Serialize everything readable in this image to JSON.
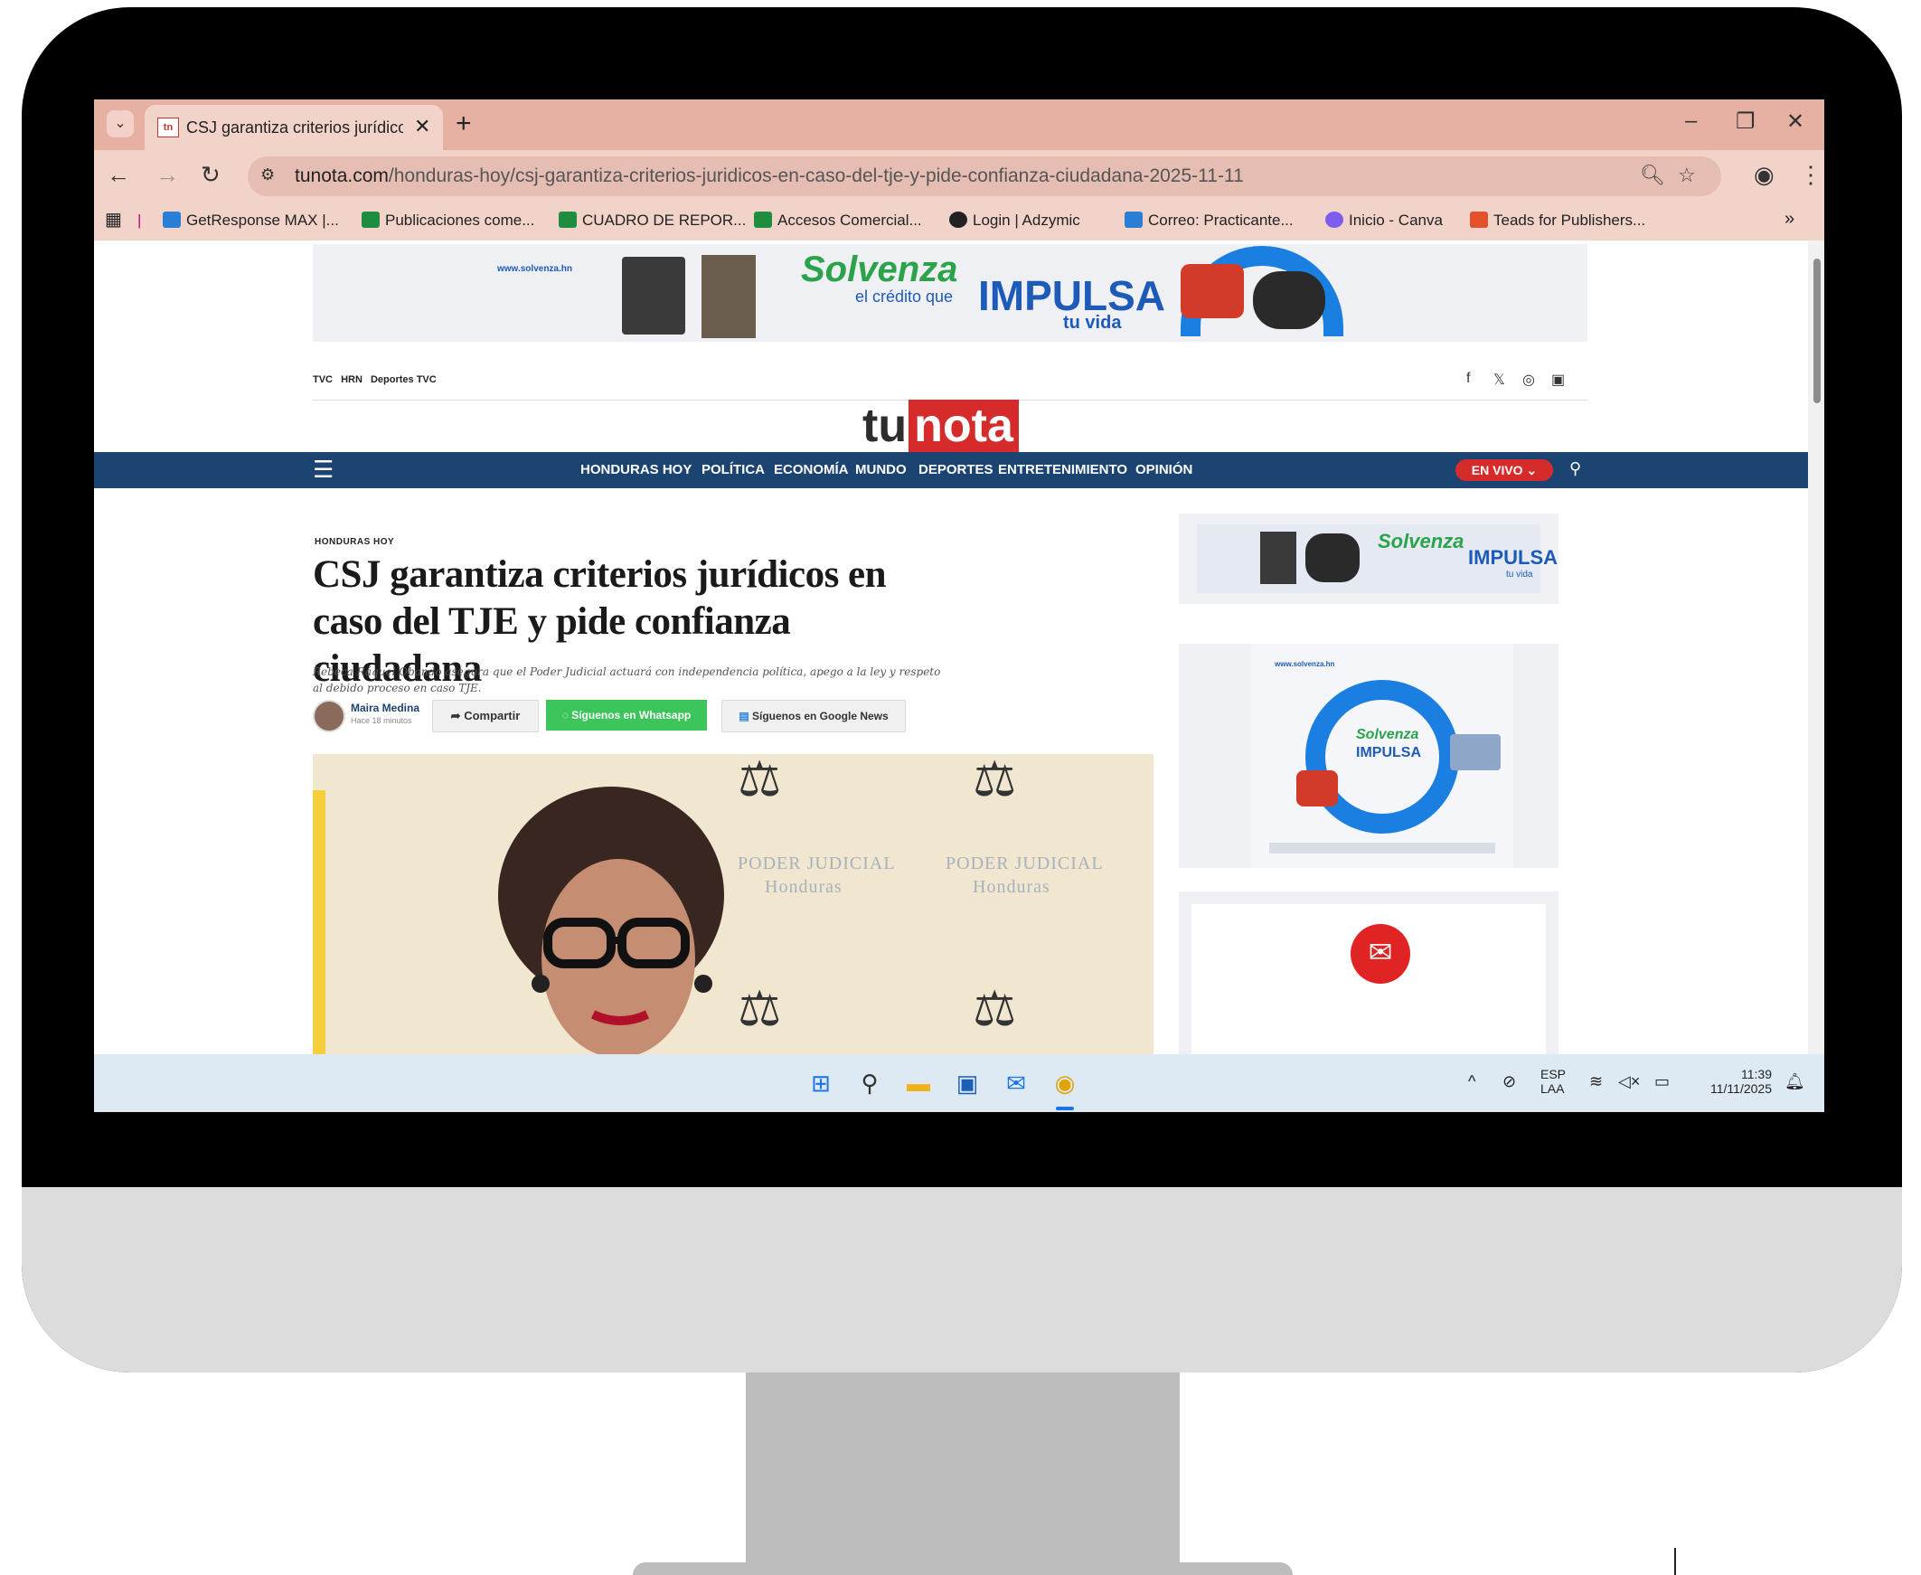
{
  "browser": {
    "tab_title": "CSJ garantiza criterios jurídicos",
    "tab_favicon": "tn",
    "url_domain": "tunota.com",
    "url_path": "/honduras-hoy/csj-garantiza-criterios-juridicos-en-caso-del-tje-y-pide-confianza-ciudadana-2025-11-11",
    "bookmarks": [
      {
        "label": "GetResponse MAX |...",
        "color": "#2a7fd4"
      },
      {
        "label": "Publicaciones come...",
        "color": "#1e8e3e"
      },
      {
        "label": "CUADRO DE REPOR...",
        "color": "#1e8e3e"
      },
      {
        "label": "Accesos Comercial...",
        "color": "#1e8e3e"
      },
      {
        "label": "Login | Adzymic",
        "color": "#222222"
      },
      {
        "label": "Correo: Practicante...",
        "color": "#2a7fd4"
      },
      {
        "label": "Inicio - Canva",
        "color": "#7d5cf0"
      },
      {
        "label": "Teads for Publishers...",
        "color": "#e2512a"
      }
    ],
    "bookmarks_overflow": "»"
  },
  "ads": {
    "top_url": "www.solvenza.hn",
    "brand": "Solvenza",
    "brand_sub": "el crédito que",
    "impulsa": "IMPULSA",
    "tu_vida": "tu vida"
  },
  "site": {
    "top_links": [
      "TVC",
      "HRN",
      "Deportes TVC"
    ],
    "social_icons": [
      "facebook-icon",
      "x-icon",
      "instagram-icon",
      "youtube-icon"
    ],
    "logo_tu": "tu",
    "logo_nota": "nota",
    "nav": [
      "HONDURAS HOY",
      "POLÍTICA",
      "ECONOMÍA",
      "MUNDO",
      "DEPORTES",
      "ENTRETENIMIENTO",
      "OPINIÓN"
    ],
    "live_label": "EN VIVO ⌄",
    "brand_color": "#1b4472",
    "accent_color": "#d62b2b"
  },
  "article": {
    "section": "HONDURAS HOY",
    "headline": "CSJ garantiza criterios jurídicos en caso del TJE y pide confianza ciudadana",
    "deck": "Rebeca Ráquel Obando asegura que el Poder Judicial actuará con independencia política, apego a la ley y respeto al debido proceso en caso TJE.",
    "author": "Maira Medina",
    "time": "Hace 18 minutos",
    "share": "Compartir",
    "whatsapp": "Síguenos en Whatsapp",
    "google_news": "Síguenos en Google News",
    "hero_text_1": "PODER JUDICIAL",
    "hero_text_2": "Honduras"
  },
  "taskbar": {
    "lang_1": "ESP",
    "lang_2": "LAA",
    "time": "11:39",
    "date": "11/11/2025"
  }
}
